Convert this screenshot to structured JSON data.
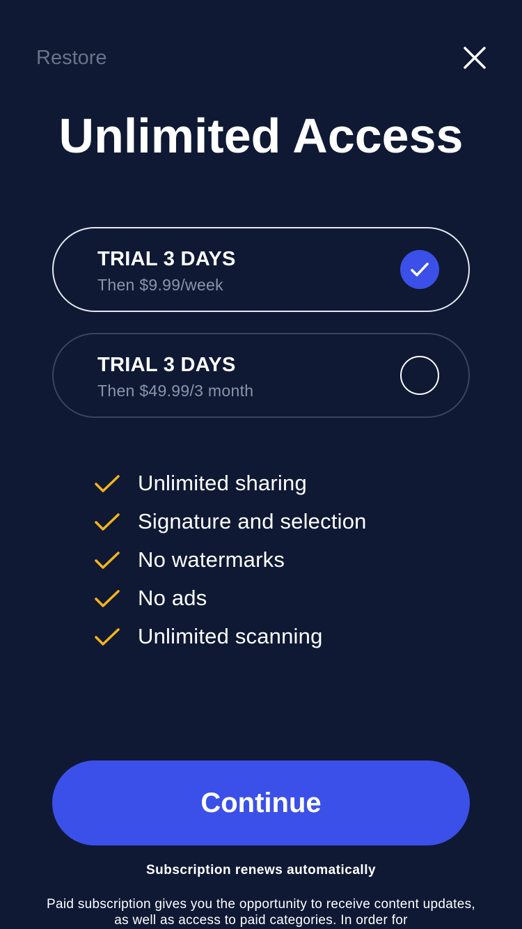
{
  "header": {
    "restore_label": "Restore",
    "close_icon": "close-icon"
  },
  "title": "Unlimited Access",
  "plans": [
    {
      "name": "TRIAL 3 DAYS",
      "price": "Then $9.99/week",
      "selected": true
    },
    {
      "name": "TRIAL 3 DAYS",
      "price": "Then $49.99/3 month",
      "selected": false
    }
  ],
  "features": [
    "Unlimited sharing",
    "Signature and selection",
    "No watermarks",
    "No ads",
    "Unlimited scanning"
  ],
  "continue_label": "Continue",
  "renews_text": "Subscription renews automatically",
  "legal_text": "Paid subscription gives you the opportunity to receive content updates, as well as access to paid categories. In order for",
  "colors": {
    "background": "#0f1934",
    "accent": "#3b50e8",
    "checkmark": "#f6b41b",
    "muted_text": "#8d94a6"
  }
}
